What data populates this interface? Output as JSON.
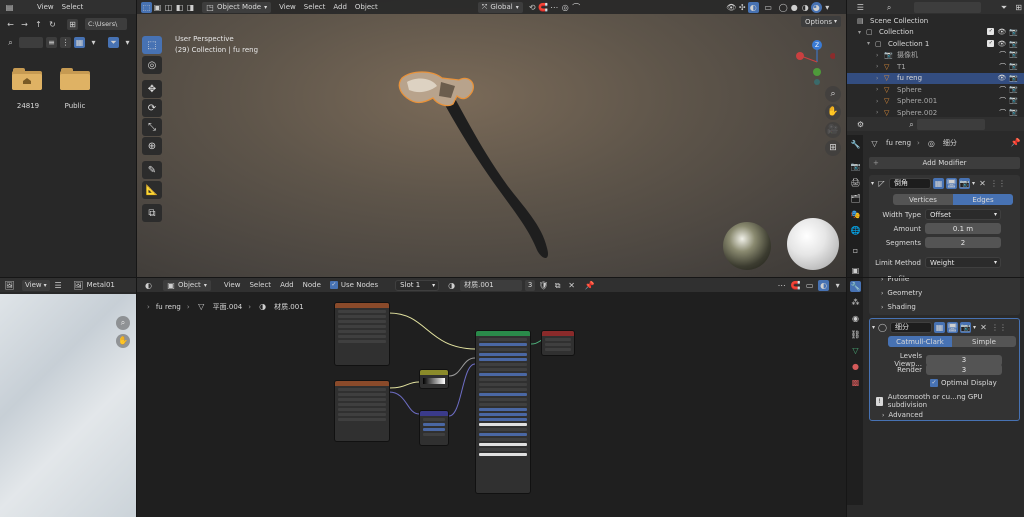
{
  "file_browser": {
    "menu": [
      "View",
      "Select"
    ],
    "path": "C:\\Users\\",
    "folders": [
      {
        "name": "24819",
        "icon": "home-folder-icon"
      },
      {
        "name": "Public",
        "icon": "folder-icon"
      }
    ]
  },
  "viewport": {
    "mode": "Object Mode",
    "menu": [
      "View",
      "Select",
      "Add",
      "Object"
    ],
    "transform_orientation": "Global",
    "options_label": "Options",
    "overlay_title": "User Perspective",
    "overlay_subtitle": "(29) Collection | fu reng",
    "gizmo_axes": [
      "Z",
      "X",
      "Y"
    ]
  },
  "outliner": {
    "rows": [
      {
        "label": "Scene Collection",
        "indent": 0,
        "icon": "scene-collection-icon",
        "selected": false
      },
      {
        "label": "Collection",
        "indent": 1,
        "icon": "collection-icon",
        "selected": false
      },
      {
        "label": "Collection 1",
        "indent": 2,
        "icon": "collection-icon",
        "selected": false
      },
      {
        "label": "摄像机",
        "indent": 3,
        "icon": "camera-icon",
        "selected": false
      },
      {
        "label": "T1",
        "indent": 3,
        "icon": "mesh-icon",
        "selected": false
      },
      {
        "label": "fu reng",
        "indent": 3,
        "icon": "mesh-icon",
        "selected": true
      },
      {
        "label": "Sphere",
        "indent": 3,
        "icon": "mesh-icon",
        "selected": false
      },
      {
        "label": "Sphere.001",
        "indent": 3,
        "icon": "mesh-icon",
        "selected": false
      },
      {
        "label": "Sphere.002",
        "indent": 3,
        "icon": "mesh-icon",
        "selected": false
      }
    ]
  },
  "properties": {
    "breadcrumb_object": "fu reng",
    "breadcrumb_modifier": "细分",
    "add_modifier": "Add Modifier",
    "bevel": {
      "name": "倒角",
      "tabs": [
        "Vertices",
        "Edges"
      ],
      "active_tab": "Edges",
      "width_type_label": "Width Type",
      "width_type_value": "Offset",
      "amount_label": "Amount",
      "amount_value": "0.1 m",
      "segments_label": "Segments",
      "segments_value": "2",
      "limit_method_label": "Limit Method",
      "limit_method_value": "Weight",
      "panels": [
        "Profile",
        "Geometry",
        "Shading"
      ]
    },
    "subsurf": {
      "name": "细分",
      "tabs": [
        "Catmull-Clark",
        "Simple"
      ],
      "active_tab": "Catmull-Clark",
      "levels_label": "Levels Viewp...",
      "levels_value": "3",
      "render_label": "Render",
      "render_value": "3",
      "optimal_display": "Optimal Display",
      "warning": "Autosmooth or cu...ng GPU subdivision",
      "advanced": "Advanced"
    }
  },
  "image_editor": {
    "view_label": "View",
    "image_name": "Metal01"
  },
  "node_editor": {
    "object_mode": "Object",
    "menu": [
      "View",
      "Select",
      "Add",
      "Node"
    ],
    "use_nodes": "Use Nodes",
    "slot": "Slot 1",
    "material": "材质.001",
    "user_count": "3",
    "breadcrumb": [
      "fu reng",
      "平面.004",
      "材质.001"
    ]
  },
  "colors": {
    "accent": "#4772b3",
    "selection_orange": "#e8923a",
    "active_row": "#334d80"
  }
}
